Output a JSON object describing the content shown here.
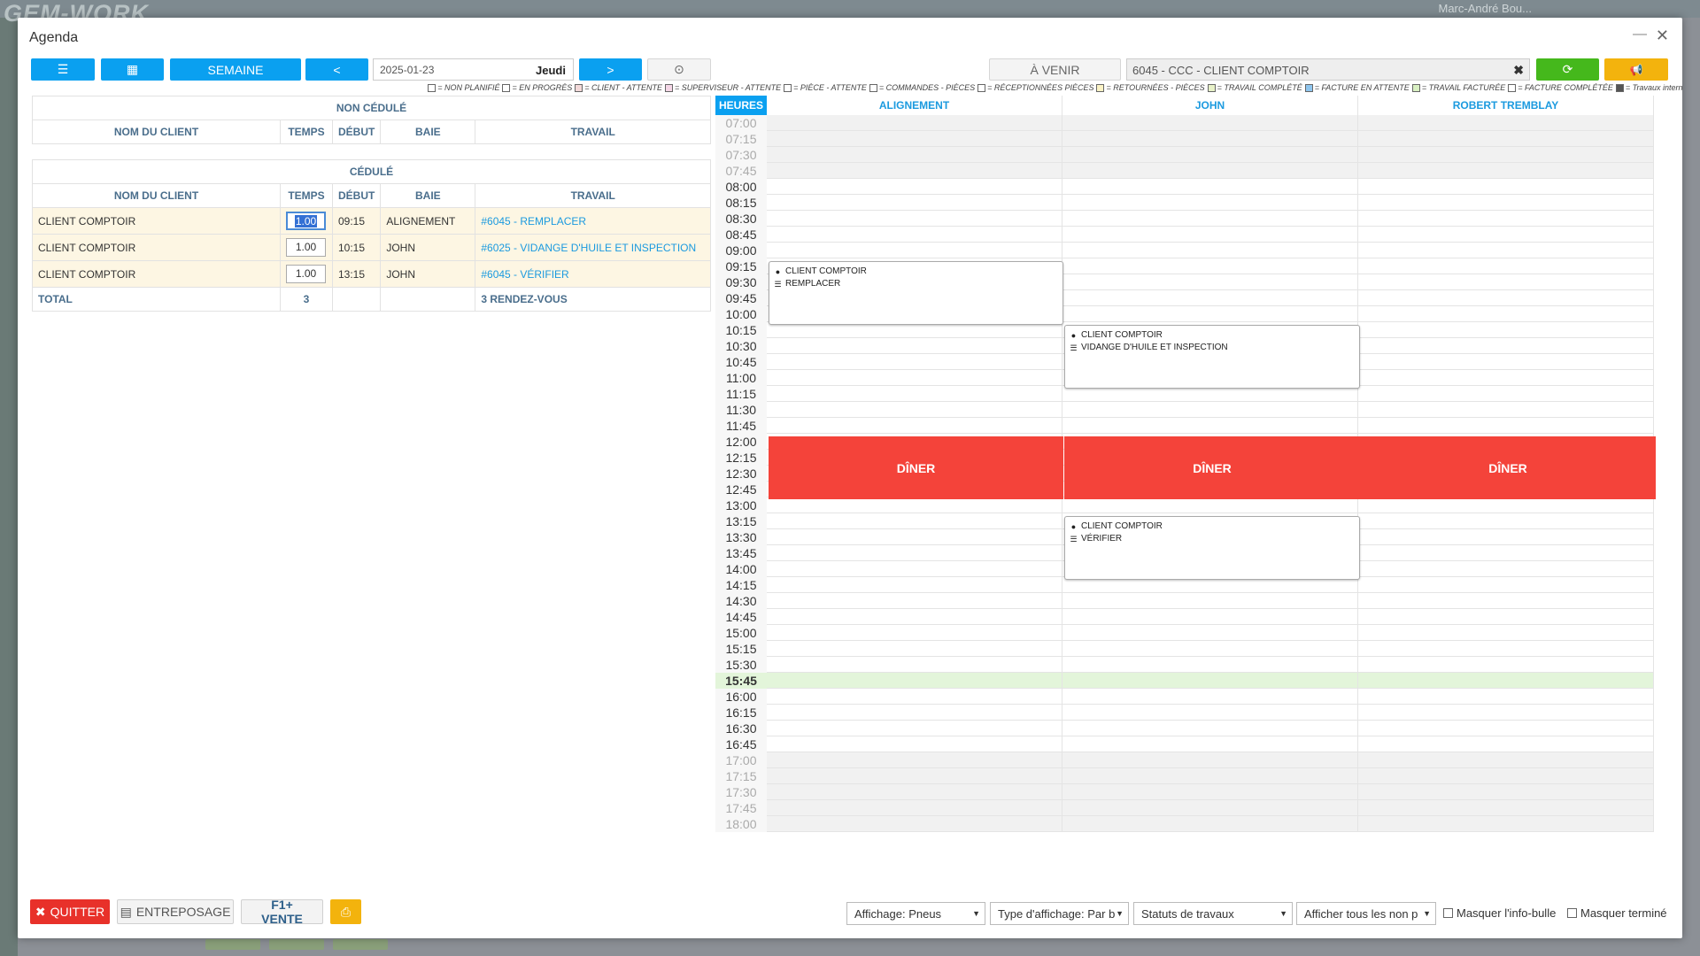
{
  "background": {
    "logo": "GEM-WORK",
    "user": "Marc-André Bou..."
  },
  "window": {
    "title": "Agenda",
    "minimize": "—",
    "close": "✕"
  },
  "toolbar": {
    "list_icon": "☰",
    "calendar_icon": "▦",
    "week_label": "SEMAINE",
    "prev_label": "<",
    "date_value": "2025-01-23",
    "day_label": "Jeudi",
    "next_label": ">",
    "clock_icon": "⊙",
    "upcoming_label": "À VENIR",
    "client_value": "6045 - CCC - CLIENT COMPTOIR",
    "clear_icon": "✖",
    "refresh_icon": "⟳",
    "announce_icon": "📢"
  },
  "legend": [
    {
      "label": "= NON PLANIFIÉ",
      "color": "#ffffff"
    },
    {
      "label": "= EN PROGRÈS",
      "color": "#ffffff"
    },
    {
      "label": "= CLIENT - ATTENTE",
      "color": "#f3d9d9"
    },
    {
      "label": "= SUPERVISEUR - ATTENTE",
      "color": "#f5d7e7"
    },
    {
      "label": "= PIÈCE - ATTENTE",
      "color": "#ffffff"
    },
    {
      "label": "= COMMANDES - PIÈCES",
      "color": "#ffffff"
    },
    {
      "label": "= RÉCEPTIONNÉES PIÈCES",
      "color": "#ffffff"
    },
    {
      "label": "= RETOURNÉES - PIÈCES",
      "color": "#fbf3c5"
    },
    {
      "label": "= TRAVAIL COMPLÉTÉ",
      "color": "#e8f2c8"
    },
    {
      "label": "= FACTURE EN ATTENTE",
      "color": "#8fc6ef"
    },
    {
      "label": "= TRAVAIL FACTURÉE",
      "color": "#d9f0c2"
    },
    {
      "label": "= FACTURE COMPLÉTÉE",
      "color": "#ffffff"
    },
    {
      "label": "= Travaux internes",
      "color": "#555555"
    }
  ],
  "unscheduled": {
    "title": "NON CÉDULÉ",
    "headers": [
      "NOM DU CLIENT",
      "TEMPS",
      "DÉBUT",
      "BAIE",
      "TRAVAIL"
    ]
  },
  "scheduled": {
    "title": "CÉDULÉ",
    "headers": [
      "NOM DU CLIENT",
      "TEMPS",
      "DÉBUT",
      "BAIE",
      "TRAVAIL"
    ],
    "rows": [
      {
        "client": "CLIENT COMPTOIR",
        "time": "1.00",
        "start": "09:15",
        "bay": "ALIGNEMENT",
        "work": "#6045 - REMPLACER"
      },
      {
        "client": "CLIENT COMPTOIR",
        "time": "1.00",
        "start": "10:15",
        "bay": "JOHN",
        "work": "#6025 - VIDANGE D'HUILE ET INSPECTION"
      },
      {
        "client": "CLIENT COMPTOIR",
        "time": "1.00",
        "start": "13:15",
        "bay": "JOHN",
        "work": "#6045 - VÉRIFIER"
      }
    ],
    "total_label": "TOTAL",
    "total_count": "3",
    "total_appointments": "3 RENDEZ-VOUS"
  },
  "calendar": {
    "hours_label": "HEURES",
    "columns": [
      "ALIGNEMENT",
      "JOHN",
      "ROBERT TREMBLAY"
    ],
    "times": [
      "07:00",
      "07:15",
      "07:30",
      "07:45",
      "08:00",
      "08:15",
      "08:30",
      "08:45",
      "09:00",
      "09:15",
      "09:30",
      "09:45",
      "10:00",
      "10:15",
      "10:30",
      "10:45",
      "11:00",
      "11:15",
      "11:30",
      "11:45",
      "12:00",
      "12:15",
      "12:30",
      "12:45",
      "13:00",
      "13:15",
      "13:30",
      "13:45",
      "14:00",
      "14:15",
      "14:30",
      "14:45",
      "15:00",
      "15:15",
      "15:30",
      "15:45",
      "16:00",
      "16:15",
      "16:30",
      "16:45",
      "17:00",
      "17:15",
      "17:30",
      "17:45",
      "18:00"
    ],
    "current_time": "15:45",
    "lunch_label": "DÎNER",
    "events": [
      {
        "client": "CLIENT COMPTOIR",
        "work": "REMPLACER"
      },
      {
        "client": "CLIENT COMPTOIR",
        "work": "VIDANGE D'HUILE ET INSPECTION"
      },
      {
        "client": "CLIENT COMPTOIR",
        "work": "VÉRIFIER"
      }
    ]
  },
  "footer": {
    "quit_label": "QUITTER",
    "quit_icon": "✖",
    "storage_label": "ENTREPOSAGE",
    "storage_icon": "▤",
    "sale_label": "F1+ VENTE",
    "print_icon": "⎙",
    "display_select": "Affichage: Pneus",
    "type_select": "Type d'affichage: Par b",
    "status_select": "Statuts de travaux",
    "show_select": "Afficher tous les non p",
    "hide_tooltip": "Masquer l'info-bulle",
    "hide_done": "Masquer terminé"
  }
}
